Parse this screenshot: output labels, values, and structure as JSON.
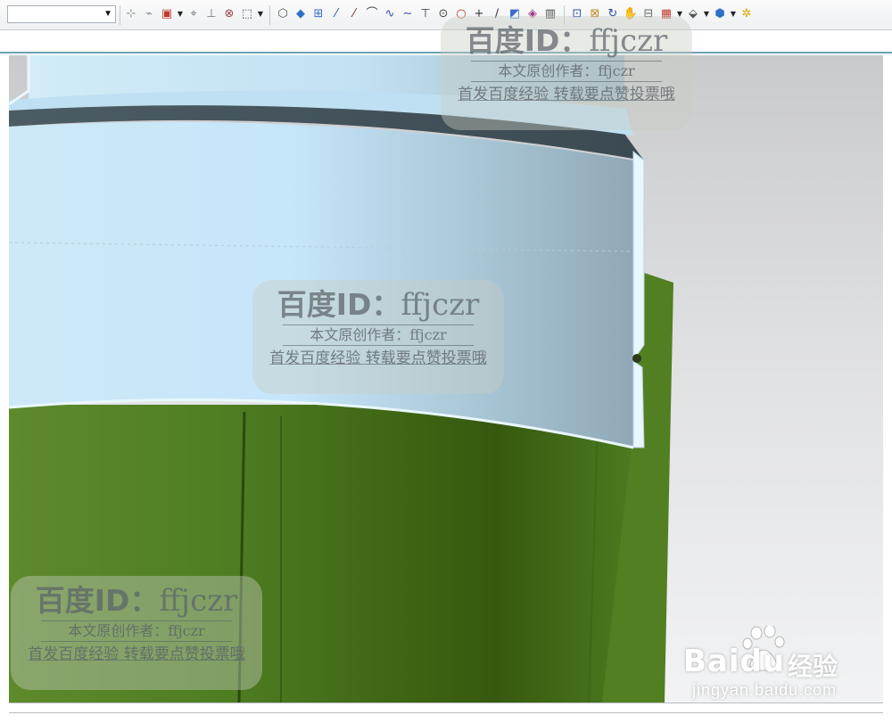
{
  "toolbar": {
    "selection_filter_value": "",
    "icons": [
      {
        "name": "snap-point-icon",
        "glyph": "⊹",
        "color": "#888888"
      },
      {
        "name": "point-on-curve-icon",
        "glyph": "⌁",
        "color": "#888888"
      },
      {
        "name": "select-feature-icon",
        "glyph": "▣",
        "color": "#c0392b"
      },
      {
        "name": "end-point-icon",
        "glyph": "⌖",
        "color": "#777777"
      },
      {
        "name": "mid-point-icon",
        "glyph": "⊥",
        "color": "#777777"
      },
      {
        "name": "intersection-point-icon",
        "glyph": "⊗",
        "color": "#a04040"
      },
      {
        "name": "rectangle-select-icon",
        "glyph": "⬚",
        "color": "#444444"
      },
      {
        "name": "solid-body-icon",
        "glyph": "⬡",
        "color": "#555555"
      },
      {
        "name": "shaded-cube-icon",
        "glyph": "◆",
        "color": "#2e6fc9"
      },
      {
        "name": "snap-grid-icon",
        "glyph": "⊞",
        "color": "#3a6bd0"
      },
      {
        "name": "line-icon",
        "glyph": "⁄",
        "color": "#2a4fa8"
      },
      {
        "name": "line-two-point-icon",
        "glyph": "⁄",
        "color": "#7a2a2a"
      },
      {
        "name": "arc-icon",
        "glyph": "⌒",
        "color": "#444444"
      },
      {
        "name": "spline-icon",
        "glyph": "∿",
        "color": "#3a4ab8"
      },
      {
        "name": "wave-curve-icon",
        "glyph": "∼",
        "color": "#3a4ab8"
      },
      {
        "name": "perpendicular-icon",
        "glyph": "⊤",
        "color": "#333333"
      },
      {
        "name": "circle-center-icon",
        "glyph": "⊙",
        "color": "#444444"
      },
      {
        "name": "circle-icon",
        "glyph": "○",
        "color": "#c0392b"
      },
      {
        "name": "cross-point-icon",
        "glyph": "+",
        "color": "#333333"
      },
      {
        "name": "tangent-line-icon",
        "glyph": "∕",
        "color": "#333333"
      },
      {
        "name": "select-face-icon",
        "glyph": "◩",
        "color": "#3a6bd0"
      },
      {
        "name": "section-view-icon",
        "glyph": "◈",
        "color": "#9b3b8a"
      },
      {
        "name": "layer-icon",
        "glyph": "▥",
        "color": "#444444"
      },
      {
        "name": "zoom-fit-icon",
        "glyph": "⊡",
        "color": "#2a4fa8"
      },
      {
        "name": "zoom-window-icon",
        "glyph": "⊠",
        "color": "#c08a20"
      },
      {
        "name": "rotate-view-icon",
        "glyph": "↻",
        "color": "#2a4fa8"
      },
      {
        "name": "pan-view-icon",
        "glyph": "✋",
        "color": "#3a6bd0"
      },
      {
        "name": "orient-view-icon",
        "glyph": "⊟",
        "color": "#666666"
      },
      {
        "name": "render-style-icon",
        "glyph": "▦",
        "color": "#c0392b"
      },
      {
        "name": "display-mode-icon",
        "glyph": "⬙",
        "color": "#555555"
      },
      {
        "name": "view-cube-icon",
        "glyph": "⬢",
        "color": "#2e6fc9"
      },
      {
        "name": "more-tools-icon",
        "glyph": "✲",
        "color": "#d9a800"
      }
    ]
  },
  "watermarks": [
    {
      "id_label": "百度ID：",
      "id_value": "ffjczr",
      "author": "本文原创作者：ffjczr",
      "slogan": "首发百度经验 转载要点赞投票哦"
    },
    {
      "id_label": "百度ID：",
      "id_value": "ffjczr",
      "author": "本文原创作者：ffjczr",
      "slogan": "首发百度经验 转载要点赞投票哦"
    },
    {
      "id_label": "百度ID：",
      "id_value": "ffjczr",
      "author": "本文原创作者：ffjczr",
      "slogan": "首发百度经验 转载要点赞投票哦"
    }
  ],
  "brand": {
    "logo_text": "Baidu",
    "product": "经验",
    "url": "jingyan.baidu.com"
  },
  "colors": {
    "accent_line": "#6fa3b3",
    "model_light_blue": "#c9e6f6",
    "model_dark_band": "#4a5a62",
    "model_green": "#4e7a20"
  }
}
